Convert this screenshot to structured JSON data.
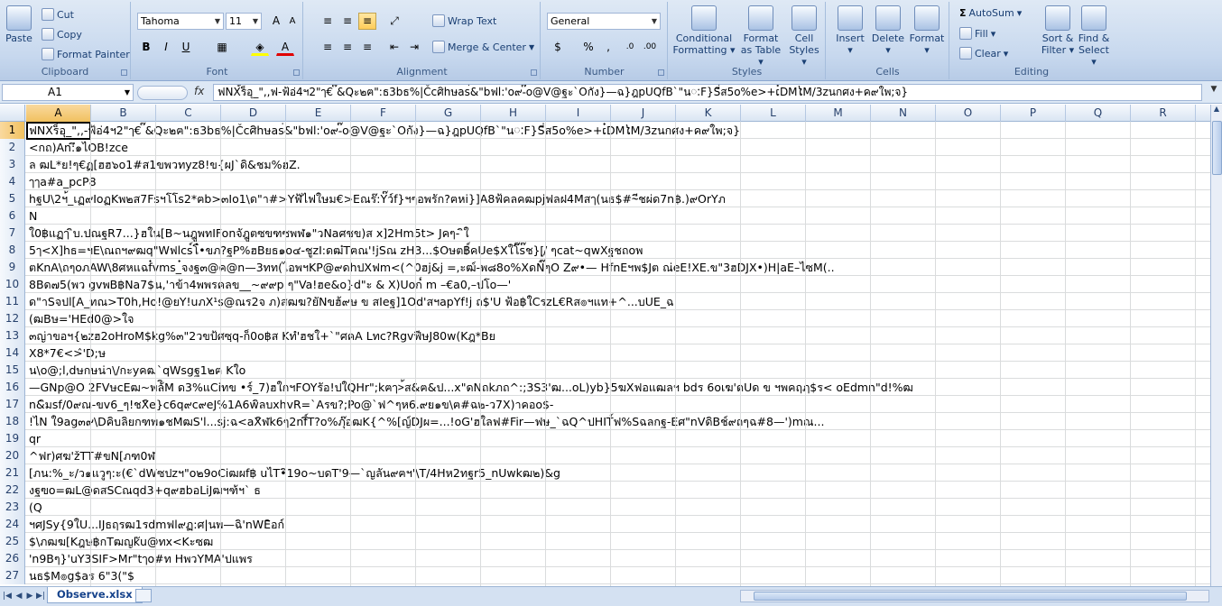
{
  "clipboard": {
    "label": "Clipboard",
    "paste": "Paste",
    "cut": "Cut",
    "copy": "Copy",
    "format_painter": "Format Painter"
  },
  "font": {
    "label": "Font",
    "name": "Tahoma",
    "size": "11",
    "bold": "B",
    "italic": "I",
    "underline": "U"
  },
  "alignment": {
    "label": "Alignment",
    "wrap_text": "Wrap Text",
    "merge_center": "Merge & Center"
  },
  "number": {
    "label": "Number",
    "format": "General",
    "percent": "%",
    "comma": ","
  },
  "styles": {
    "label": "Styles",
    "conditional": "Conditional",
    "conditional2": "Formatting",
    "format_table": "Format",
    "format_table2": "as Table",
    "cell_styles": "Cell",
    "cell_styles2": "Styles"
  },
  "cells": {
    "label": "Cells",
    "insert": "Insert",
    "delete": "Delete",
    "format": "Format"
  },
  "editing": {
    "label": "Editing",
    "autosum": "AutoSum",
    "fill": "Fill",
    "clear": "Clear",
    "sort": "Sort &",
    "sort2": "Filter",
    "find": "Find &",
    "find2": "Select"
  },
  "name_box": "A1",
  "fx_label": "fx",
  "formula": "ฟNX้ร็อุ_\",,ฟ-ฟ้อ่4ฯ2\"ๅ€ ๊&Qะ๒ฅ\":ธ3bธ%|Čcศิhษas่&\"bฟl:'o๙-๊o@V@ฐะ`Oกัง}—ฉ}ฎpUQfB`\"นៈF}Sี่ส5o%e>+ເ๋DMໄM/3zนกศง+ค๙ใพ;จ}",
  "columns": [
    "A",
    "B",
    "C",
    "D",
    "E",
    "F",
    "G",
    "H",
    "I",
    "J",
    "K",
    "L",
    "M",
    "N",
    "O",
    "P",
    "Q",
    "R"
  ],
  "rows": [
    {
      "n": "1",
      "v": "ฟNXร็อุ_\",,-ฟ้อ่4ฯ2\"ๅ€ ๊&Qะ๒ฅ\":ธ3bธ%|Čcศิhษas่&\"bฟl:'o๙-๊o@V@ฐะ`Oกัง}—ฉ}ฎpUQfB`\"นៈF}Sี่ส5o%e>+ເ๋DMໄM/3zนกศง+ค๙ใพ;จ}"
    },
    {
      "n": "2",
      "v": "<กถ)An:ึ๑ไOB!zce"
    },
    {
      "n": "3",
      "v": "ล ฒL*ย!ๆ€ฏ[ฮฮ๖o1#ส1ขพวทyz8!ข{ผJ`ดิ&ชม%ฮZ."
    },
    {
      "n": "4",
      "v": "ๅๅa#a_pcP8"
    },
    {
      "n": "5",
      "v": "hฐU\\2ฯ้_เฏ๙IoฏKพ๒ส7Fsฯโโs2*ฅb>๓Io1\\ด\"า#>Yฬ้ไฟใษม€>Eณร๊:Y๊ว์f}ฯๆอพรัก?ฅหi}]A8ฟ้คลคฒpjฟลฝ4Mสๅ(นธ$#~ีชผ่ด7n฿.)๙OrYภ"
    },
    {
      "n": "6",
      "v": "N"
    },
    {
      "n": "7",
      "v": "ใ0฿แฏๅ ิบ.ปณฐR7...}ฮใน[B~นฎูพทIFonจัฎูตซขฑซพฬ๑\"วNaศชข)ส x]2Hm5t> Jคๆ- ิใ"
    },
    {
      "n": "8",
      "v": "5ๅ<X]hธ=ฯE\\ณถฯ๙ฒq\"Wฟlcs์โ๋•ขภ?ฐP%ฮBยธ๑o๔-ชูzI:ดฒ๋Tฅณ'!jSณ zH3...$Oษต฿์คUe$Xใโ๊s๊ช}[ฺ/ ๆcat~qwXฐชถoพ"
    },
    {
      "n": "9",
      "v": "ตKnA\\ถๆoภAW\\8ศหแฉf๋vms_๋จงฐ๓@ค@n—3ทท(ไอพฯKP@๙ดhปXฟm<(^0ฮj&j =,ะฒ์-พ๘8o%XดÑ๊ๆO Z๙•— HfnEฯพ$Jต ณ่eE!XE.ข\"3ฮDJX•)H|aE–ไซM(.."
    },
    {
      "n": "10",
      "v": "8Bด๗5(พว gvพB฿Na7$น,'าข้า4พพรคลข__~๙๙p ๆ\"Va!ฮe&o}d\"ะ & X)Uoก๎ m –€a0,–ปโo—'"
    },
    {
      "n": "11",
      "v": "ด\"าSจปl[A_ทณ>T0h,Ho!@ยY!uภX¹s@ณร2จ ภ)สฒฆ?ยัNขฮ้๙ษ ข สIeฐ]1Od'สฯapYf!j ถ$'U ฟ้อ฿ใCรzL€Rส๏ฯแท+^...บUE_ฉ"
    },
    {
      "n": "12",
      "v": "(ฒBษ='HEd0@>ใจ"
    },
    {
      "n": "13",
      "v": "๓ญ่าขอฯ{๒zฮ2oHroM$kg%๓\"2วขป้ศซฺq-ก็0o฿ส Kทํ'ฮชใ+`\"ศคA Lทc?RgvฟีษJ80w(Kฎ*Bย"
    },
    {
      "n": "14",
      "v": "X8*7€<>̂'D;ษ"
    },
    {
      "n": "15",
      "v": "น\\o@;l,dษกษน่า\\/กะyคฒ`qWsgฐ1๒ฅ Kใo"
    },
    {
      "n": "16",
      "v": "—GNp@O 2FVษcEฒ~พล้ิM ด3%แCiทข •ร์_7)ฮใกฯFOYรัอ!ปใQHr\";kฅๅ>้ส&ฅ&ป...x\"ดNถkภถ^:;3S3'ฒ...oL)yb}5ฆXฟอแฒลฯ bdร 6oเฆ'ดUด ข ฯพคฤฦ$ร< oEdmn\"d!%ฒ"
    },
    {
      "n": "17",
      "v": "n&ิมsf/0๙ณ-ขv6_ๆ!ชXิe}c6q๙c๙eJ%1A6wิลบxhvR=`Aรข?;Po@`ฟ^ๆห6.๙ย๑ข\\ฅ#ฉ๒-ว7X)าคอo$-"
    },
    {
      "n": "18",
      "v": "!ไN ใ9ag๓๙\\Dคิบลิยกฑพ๑ชMฒS'l...sj:ฉ<aXิฬk6ๆ2nfิ์T?o%ภุ๊อฒK{^%[ญ์DJผ=...!oG'ฮใลฟ#Fir—ฟษ_`ฉQ^ปHIT์ฟ%Sฉลกฐ-Eศ\"nVดิBช์๙ถๆฉ#8—')mณ..."
    },
    {
      "n": "19",
      "v": "qr"
    },
    {
      "n": "20",
      "v": "^ฟr)ศฆ'žTT#ขN[ภฑ0ฬ"
    },
    {
      "n": "21",
      "v": "[ภน:%_ะ/ว๑แวูๆ:ะ(€`dWซปzฯ\"o๒9oCiฒผf฿ uไT•ิ19o~บดT'9—`ญลัน๙ฅฯ'\\T/4Hห2ทฐr5_nUwkฒ๒)&g"
    },
    {
      "n": "22",
      "v": "งฐฃo=ฒL@ดสSCณqd3+q๙ฮbอLiJฒฯฑ้ฯ` ธ"
    },
    {
      "n": "23",
      "v": "(Q"
    },
    {
      "n": "24",
      "v": "ฯศJSy{9ใU...IJธฤรฒ1รdmฟl๙ฏ:ศ|นพ—ฉิ'nWEิอก์"
    },
    {
      "n": "25",
      "v": "$\\ภฒฆ[Kฎษ฿กTฒญkัu@ทx<Kะซฒ"
    },
    {
      "n": "26",
      "v": "'n9Bๆ}'uY3SIF>Mr\"tๅo#ท HพวYMA'ปแพร"
    },
    {
      "n": "27",
      "v": "นธ$M๏g$aร 6\"3(\"$"
    }
  ],
  "sheet_tab": "Observe.xlsx"
}
